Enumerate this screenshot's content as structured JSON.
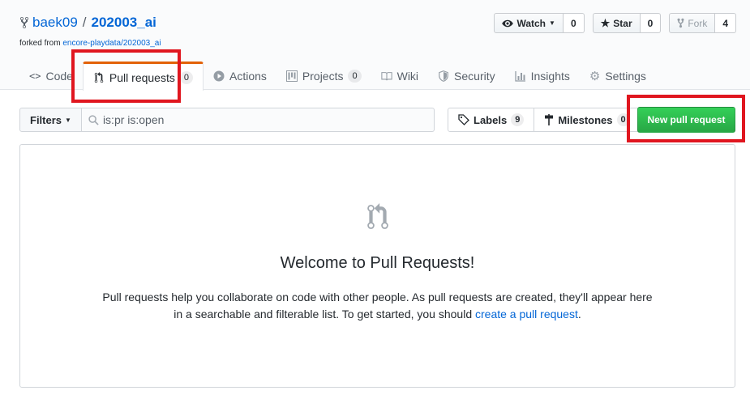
{
  "repo": {
    "owner": "baek09",
    "separator": "/",
    "name": "202003_ai",
    "forked_prefix": "forked from",
    "forked_from": "encore-playdata/202003_ai"
  },
  "actions": {
    "watch": {
      "label": "Watch",
      "count": "0",
      "icon": "eye-icon"
    },
    "star": {
      "label": "Star",
      "count": "0",
      "icon": "star-icon"
    },
    "fork": {
      "label": "Fork",
      "count": "4",
      "icon": "repo-forked-icon"
    }
  },
  "tabs": [
    {
      "label": "Code",
      "icon": "code-icon"
    },
    {
      "label": "Pull requests",
      "counter": "0",
      "icon": "git-pull-request-icon",
      "selected": true
    },
    {
      "label": "Actions",
      "icon": "play-icon"
    },
    {
      "label": "Projects",
      "counter": "0",
      "icon": "project-icon"
    },
    {
      "label": "Wiki",
      "icon": "book-icon"
    },
    {
      "label": "Security",
      "icon": "shield-icon"
    },
    {
      "label": "Insights",
      "icon": "graph-icon"
    },
    {
      "label": "Settings",
      "icon": "gear-icon"
    }
  ],
  "filters": {
    "label": "Filters",
    "search_value": "is:pr is:open"
  },
  "labels_link": {
    "label": "Labels",
    "count": "9"
  },
  "milestones_link": {
    "label": "Milestones",
    "count": "0"
  },
  "new_pr_button": "New pull request",
  "blankslate": {
    "title": "Welcome to Pull Requests!",
    "text": "Pull requests help you collaborate on code with other people. As pull requests are created, they'll appear here in a searchable and filterable list. To get started, you should",
    "link": "create a pull request",
    "end": "."
  },
  "colors": {
    "accent": "#0366d6",
    "tab_underline": "#e36209",
    "new_pr_green": "#2ea44f",
    "annotation_red": "#e0161f"
  }
}
